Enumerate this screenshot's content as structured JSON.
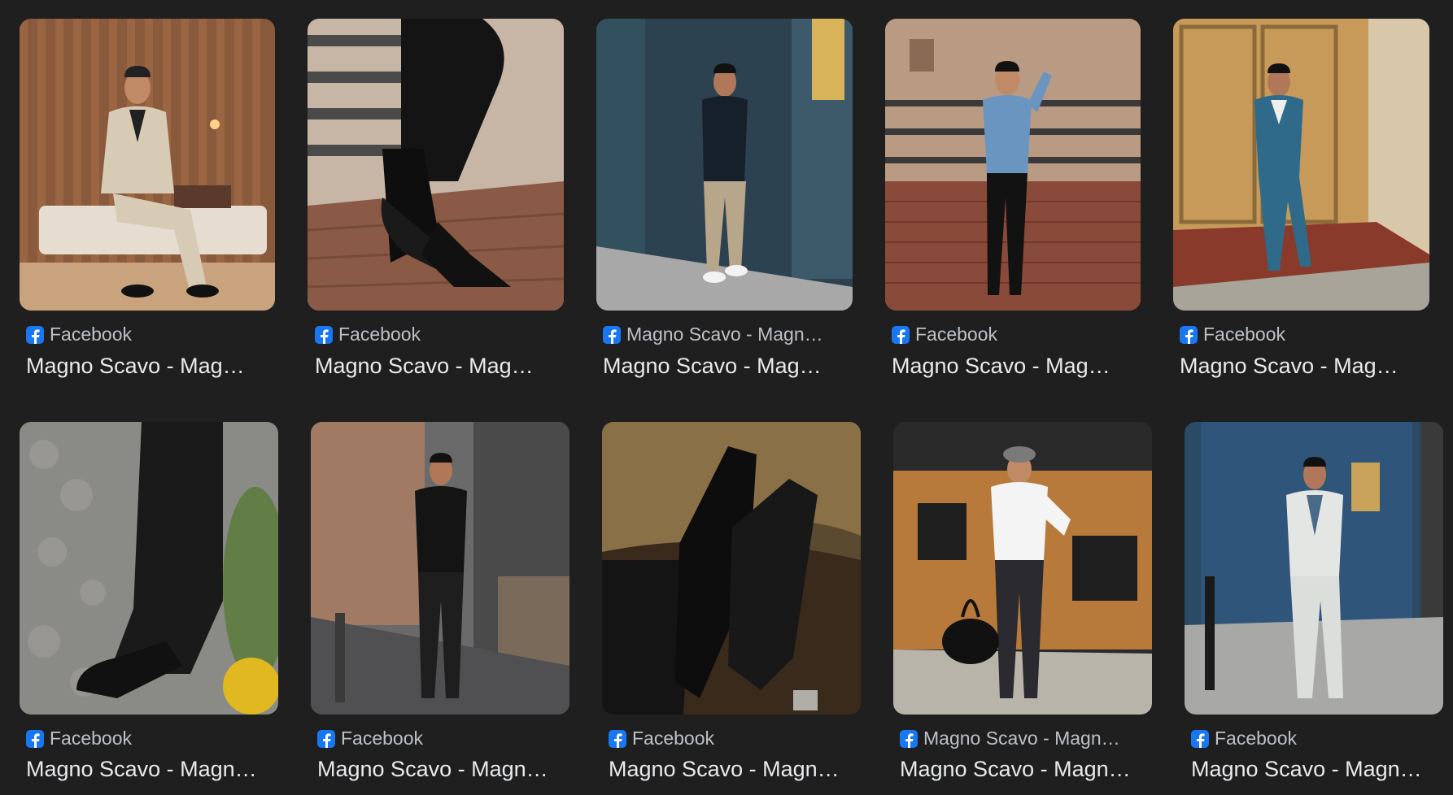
{
  "results": [
    {
      "source": "Facebook",
      "title": "Magno Scavo - Mag…",
      "scene": "studio-beige-suit"
    },
    {
      "source": "Facebook",
      "title": "Magno Scavo - Mag…",
      "scene": "boots-on-wall"
    },
    {
      "source": "Magno Scavo - Magn…",
      "title": "Magno Scavo - Mag…",
      "scene": "blue-wall-polo"
    },
    {
      "source": "Facebook",
      "title": "Magno Scavo - Mag…",
      "scene": "brick-wall-denim"
    },
    {
      "source": "Facebook",
      "title": "Magno Scavo - Mag…",
      "scene": "teal-suit-doorway"
    },
    {
      "source": "Facebook",
      "title": "Magno Scavo - Magn…",
      "scene": "monk-shoes-cobble"
    },
    {
      "source": "Facebook",
      "title": "Magno Scavo - Magn…",
      "scene": "leather-pants-street"
    },
    {
      "source": "Facebook",
      "title": "Magno Scavo - Magn…",
      "scene": "chelsea-boots-closeup"
    },
    {
      "source": "Magno Scavo - Magn…",
      "title": "Magno Scavo - Magn…",
      "scene": "white-shirt-duffel"
    },
    {
      "source": "Facebook",
      "title": "Magno Scavo - Magn…",
      "scene": "white-suit-blue-wall"
    }
  ],
  "colors": {
    "background": "#1f1f1f",
    "source_text": "#bdc1c6",
    "title_text": "#e8eaed",
    "facebook_blue": "#1877f2"
  }
}
